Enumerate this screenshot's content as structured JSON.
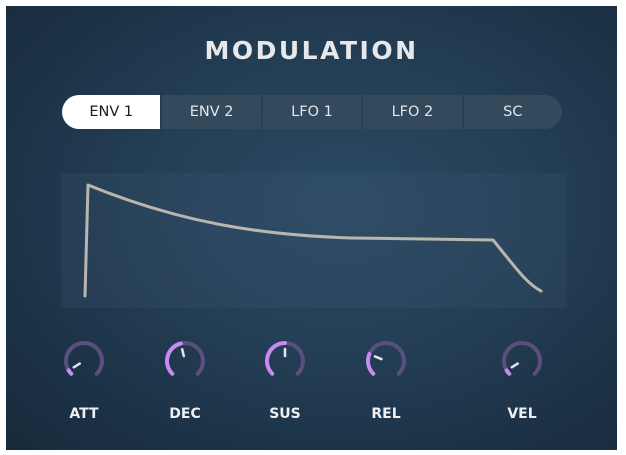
{
  "title": "MODULATION",
  "tabs": [
    {
      "label": "ENV 1",
      "active": true
    },
    {
      "label": "ENV 2",
      "active": false
    },
    {
      "label": "LFO 1",
      "active": false
    },
    {
      "label": "LFO 2",
      "active": false
    },
    {
      "label": "SC",
      "active": false
    }
  ],
  "knobs": [
    {
      "label": "ATT",
      "value": 0.05
    },
    {
      "label": "DEC",
      "value": 0.45
    },
    {
      "label": "SUS",
      "value": 0.5
    },
    {
      "label": "REL",
      "value": 0.25
    },
    {
      "label": "VEL",
      "value": 0.05
    }
  ],
  "colors": {
    "accent": "#c98af0",
    "knob_track": "#5a4f7e",
    "envelope_line": "#b9b6b0"
  }
}
